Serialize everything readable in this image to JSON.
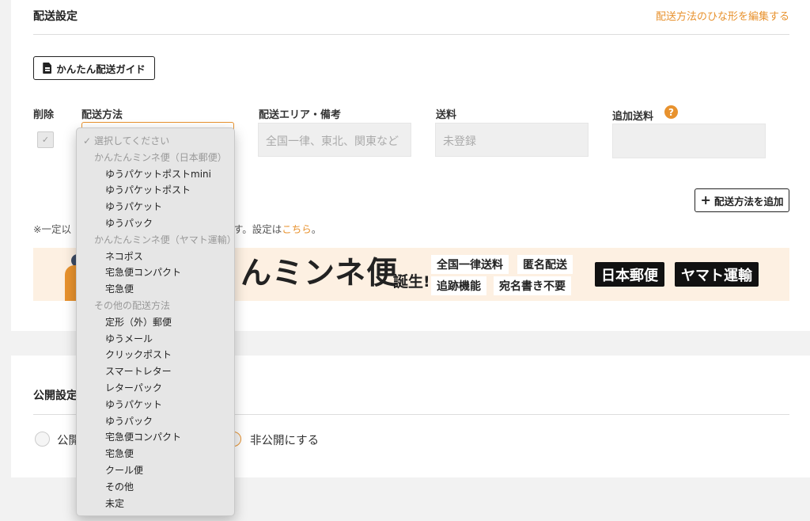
{
  "shipping": {
    "title": "配送設定",
    "edit_template_link": "配送方法のひな形を編集する",
    "guide_button": "かんたん配送ガイド",
    "columns": {
      "delete": "削除",
      "method": "配送方法",
      "area": "配送エリア・備考",
      "fee": "送料",
      "extra_fee": "追加送料"
    },
    "inputs": {
      "area_placeholder": "全国一律、東北、関東など",
      "fee_value": "未登録"
    },
    "add_button": "配送方法を追加",
    "note": {
      "prefix": "※一定以",
      "suffix": "す。設定は",
      "link": "こちら",
      "end": "。"
    },
    "banner": {
      "headline": "んミンネ便",
      "sub": "誕生!",
      "tags": [
        "全国一律送料",
        "匿名配送",
        "追跡機能",
        "宛名書き不要"
      ],
      "carriers": [
        "日本郵便",
        "ヤマト運輸"
      ]
    }
  },
  "publish": {
    "title": "公開設定",
    "options": {
      "public": "公開",
      "private": "非公開にする"
    },
    "selected": "private"
  },
  "dropdown": {
    "selected": "選択してください",
    "selected_check": "✓",
    "groups": [
      {
        "label": "かんたんミンネ便（日本郵便）",
        "items": [
          "ゆうパケットポストmini",
          "ゆうパケットポスト",
          "ゆうパケット",
          "ゆうパック"
        ]
      },
      {
        "label": "かんたんミンネ便（ヤマト運輸）",
        "items": [
          "ネコポス",
          "宅急便コンパクト",
          "宅急便"
        ]
      },
      {
        "label": "その他の配送方法",
        "items": [
          "定形（外）郵便",
          "ゆうメール",
          "クリックポスト",
          "スマートレター",
          "レターパック",
          "ゆうパケット",
          "ゆうパック",
          "宅急便コンパクト",
          "宅急便",
          "クール便",
          "その他",
          "未定"
        ]
      }
    ]
  },
  "icons": {
    "guide": "document-icon",
    "help": "question-icon",
    "add": "plus-icon",
    "check": "check-icon"
  },
  "colors": {
    "accent": "#e8922e",
    "banner_bg": "#fdf0e2"
  }
}
